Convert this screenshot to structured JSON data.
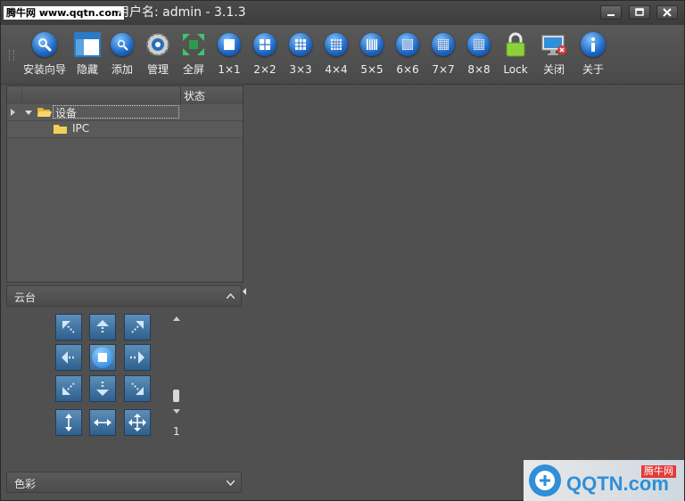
{
  "watermark": "腾牛网 www.qqtn.com",
  "window": {
    "title": "用户名: admin - 3.1.3"
  },
  "window_controls": {
    "minimize": "minimize",
    "maximize": "maximize",
    "close": "close"
  },
  "toolbar": {
    "items": [
      {
        "label": "安装向导",
        "icon": "wizard-icon"
      },
      {
        "label": "隐藏",
        "icon": "hide-panel-icon"
      },
      {
        "label": "添加",
        "icon": "search-add-icon"
      },
      {
        "label": "管理",
        "icon": "gear-icon"
      },
      {
        "label": "全屏",
        "icon": "fullscreen-icon"
      },
      {
        "label": "1×1",
        "icon": "layout-1x1-icon"
      },
      {
        "label": "2×2",
        "icon": "layout-2x2-icon"
      },
      {
        "label": "3×3",
        "icon": "layout-3x3-icon"
      },
      {
        "label": "4×4",
        "icon": "layout-4x4-icon"
      },
      {
        "label": "5×5",
        "icon": "layout-5x5-icon"
      },
      {
        "label": "6×6",
        "icon": "layout-6x6-icon"
      },
      {
        "label": "7×7",
        "icon": "layout-7x7-icon"
      },
      {
        "label": "8×8",
        "icon": "layout-8x8-icon"
      },
      {
        "label": "Lock",
        "icon": "lock-icon"
      },
      {
        "label": "关闭",
        "icon": "close-screen-icon"
      },
      {
        "label": "关于",
        "icon": "info-icon"
      }
    ]
  },
  "device_tree": {
    "column_status": "状态",
    "root": {
      "label": "设备",
      "icon": "folder-open-icon"
    },
    "child": {
      "label": "IPC",
      "icon": "folder-icon"
    }
  },
  "ptz_panel": {
    "title": "云台",
    "speed_value": "1"
  },
  "color_panel": {
    "title": "色彩"
  },
  "brand_logo": {
    "text": "QQTN.com",
    "badge": "腾牛网"
  },
  "colors": {
    "accent": "#1d67c4",
    "panel": "#505050",
    "ptz_button": "#3e76a8"
  }
}
